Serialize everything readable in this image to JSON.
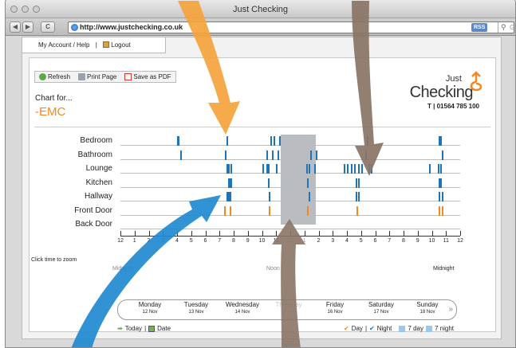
{
  "window": {
    "title": "Just Checking"
  },
  "browser": {
    "back": "◀",
    "forward": "▶",
    "reload": "C",
    "url": "http://www.justchecking.co.uk",
    "rss": "RSS",
    "search_placeholder": "Google"
  },
  "topnav": {
    "account": "My Account / Help",
    "sep": "|",
    "logout": "Logout"
  },
  "toolbar": {
    "refresh": "Refresh",
    "print": "Print Page",
    "pdf": "Save as PDF"
  },
  "header": {
    "chart_for": "Chart for...",
    "client": "-EMC"
  },
  "logo": {
    "just": "Just",
    "checking": "Checking",
    "phone": "T | 01564 785 100"
  },
  "rows": [
    "Bedroom",
    "Bathroom",
    "Lounge",
    "Kitchen",
    "Hallway",
    "Front Door",
    "Back Door"
  ],
  "axis": {
    "zoom_label": "Click time to zoom",
    "ticks": [
      "12",
      "1",
      "2",
      "3",
      "4",
      "5",
      "6",
      "7",
      "8",
      "9",
      "10",
      "11",
      "12",
      "1",
      "2",
      "3",
      "4",
      "5",
      "6",
      "7",
      "8",
      "9",
      "10",
      "11",
      "12"
    ],
    "start_label": "Midnight",
    "noon_label": "Noon",
    "end_label": "Midnight"
  },
  "days": [
    {
      "name": "Monday",
      "date": "12 Nov"
    },
    {
      "name": "Tuesday",
      "date": "13 Nov"
    },
    {
      "name": "Wednesday",
      "date": "14 Nov"
    },
    {
      "name": "Thursday",
      "date": "15 Nov"
    },
    {
      "name": "Friday",
      "date": "16 Nov"
    },
    {
      "name": "Saturday",
      "date": "17 Nov"
    },
    {
      "name": "Sunday",
      "date": "18 Nov"
    }
  ],
  "day_next": "»",
  "bottom": {
    "today": "Today",
    "sep": "|",
    "date": "Date",
    "day": "Day",
    "sep2": "|",
    "night": "Night",
    "week": "7 day",
    "week_night": "7 night"
  },
  "colors": {
    "activity": "#1f73b7",
    "door": "#f08a1a",
    "accent": "#f08a1a",
    "selection": "#b9bcc1"
  },
  "chart_data": {
    "type": "timeline",
    "x_axis": "hour of day (0-24)",
    "rows": [
      {
        "name": "Bedroom",
        "events": [
          4.0,
          4.05,
          7.5,
          10.6,
          10.8,
          11.2,
          17.4,
          22.5,
          22.6
        ]
      },
      {
        "name": "Bathroom",
        "events": [
          4.2,
          7.4,
          10.3,
          10.7,
          11.1,
          13.4,
          13.8,
          17.3,
          22.7
        ]
      },
      {
        "name": "Lounge",
        "events": [
          7.5,
          7.6,
          7.8,
          10.0,
          10.3,
          10.4,
          11.0,
          13.1,
          13.3,
          13.7,
          15.8,
          16.0,
          16.3,
          16.5,
          16.8,
          17.0,
          17.5,
          17.7,
          21.8,
          22.4,
          22.6
        ]
      },
      {
        "name": "Kitchen",
        "events": [
          7.6,
          7.7,
          7.8,
          10.4,
          13.2,
          16.6,
          16.8,
          22.5,
          22.6
        ]
      },
      {
        "name": "Hallway",
        "events": [
          7.5,
          7.6,
          7.7,
          10.5,
          13.3,
          16.6,
          16.8,
          22.5,
          22.7
        ]
      },
      {
        "name": "Front Door",
        "events": [
          7.3,
          7.7,
          10.5,
          13.2,
          16.7,
          22.5,
          22.7
        ]
      },
      {
        "name": "Back Door",
        "events": []
      }
    ],
    "selection": [
      11.3,
      13.8
    ]
  }
}
